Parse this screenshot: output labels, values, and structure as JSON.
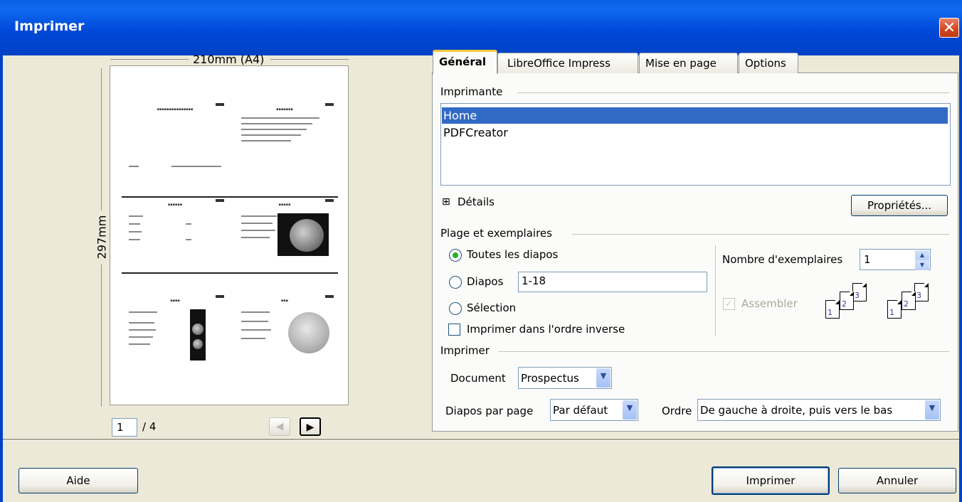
{
  "window": {
    "title": "Imprimer",
    "close_glyph": "✕"
  },
  "preview": {
    "width_label": "210mm (A4)",
    "height_label": "297mm",
    "page_input": "1",
    "page_total": "/ 4",
    "prev_glyph": "◀",
    "next_glyph": "▶"
  },
  "tabs": [
    "Général",
    "LibreOffice Impress",
    "Mise en page",
    "Options"
  ],
  "printer": {
    "group_label": "Imprimante",
    "items": [
      "Home",
      "PDFCreator"
    ],
    "selected": "Home",
    "details_toggle": "⊞",
    "details_label": "Détails",
    "properties_button": "Propriétés..."
  },
  "range": {
    "group_label": "Plage et exemplaires",
    "all_slides": "Toutes les diapos",
    "slides": "Diapos",
    "slides_value": "1-18",
    "selection": "Sélection",
    "reverse_order": "Imprimer dans l'ordre inverse",
    "copies_label": "Nombre d'exemplaires",
    "copies_value": "1",
    "collate": "Assembler"
  },
  "print": {
    "group_label": "Imprimer",
    "document_label": "Document",
    "document_value": "Prospectus",
    "slides_per_page_label": "Diapos par page",
    "slides_per_page_value": "Par défaut",
    "order_label": "Ordre",
    "order_value": "De gauche à droite, puis vers le bas"
  },
  "buttons": {
    "help": "Aide",
    "print": "Imprimer",
    "cancel": "Annuler"
  }
}
